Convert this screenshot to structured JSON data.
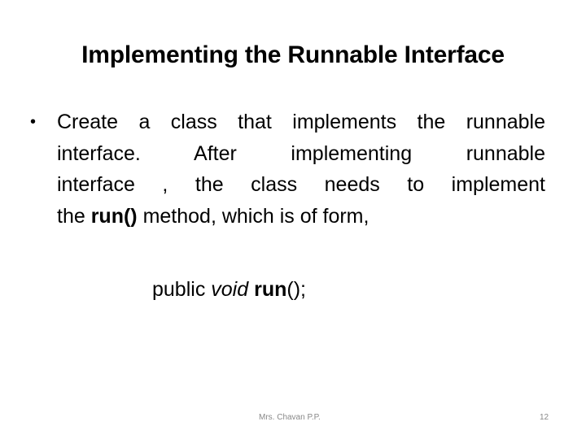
{
  "slide": {
    "title": "Implementing the Runnable Interface",
    "bullet": {
      "marker": "•",
      "lines": [
        "Create a class that implements the runnable",
        "interface. After implementing runnable",
        "interface , the class needs to implement"
      ],
      "last_line": {
        "prefix": "the ",
        "bold": "run()",
        "suffix": " method, which is of form,"
      }
    },
    "code": {
      "part1": "public ",
      "part2_italic": "void",
      "part3": " ",
      "part4_bold": "run",
      "part5": "();"
    },
    "footer": {
      "author": "Mrs. Chavan P.P.",
      "page_number": "12"
    }
  }
}
